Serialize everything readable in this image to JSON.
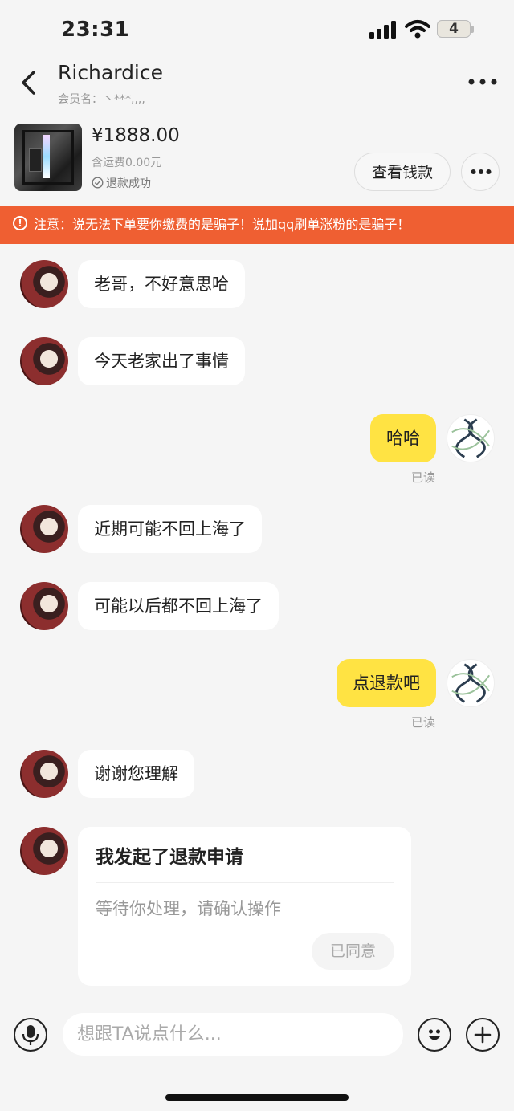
{
  "status_bar": {
    "time": "23:31",
    "battery": "4"
  },
  "header": {
    "title": "Richardice",
    "member": "会员名：丶***,,,,"
  },
  "product": {
    "price": "¥1888.00",
    "shipping": "含运费0.00元",
    "status": "退款成功",
    "view_button": "查看钱款"
  },
  "warning": "注意：说无法下单要你缴费的是骗子！说加qq刷单涨粉的是骗子！",
  "messages": [
    {
      "text": "老哥，不好意思哈"
    },
    {
      "text": "今天老家出了事情"
    },
    {
      "text": "哈哈",
      "read": "已读"
    },
    {
      "text": "近期可能不回上海了"
    },
    {
      "text": "可能以后都不回上海了"
    },
    {
      "text": "点退款吧",
      "read": "已读"
    },
    {
      "text": "谢谢您理解"
    }
  ],
  "refund_card": {
    "title": "我发起了退款申请",
    "subtitle": "等待你处理，请确认操作",
    "button": "已同意"
  },
  "input": {
    "placeholder": "想跟TA说点什么..."
  },
  "colors": {
    "warning": "#ef5f32",
    "my_bubble": "#ffe343",
    "background": "#f5f5f5"
  }
}
